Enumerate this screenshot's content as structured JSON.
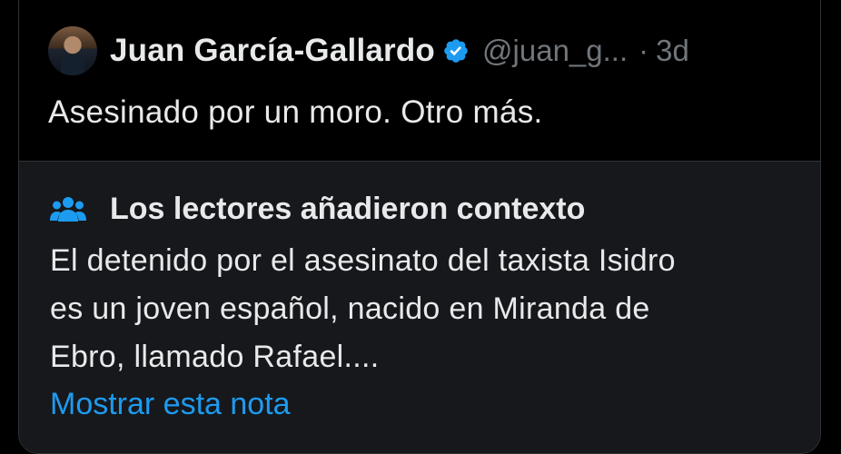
{
  "tweet": {
    "author_name": "Juan García-Gallardo",
    "handle": "@juan_g...",
    "separator": "·",
    "time": "3d",
    "text": "Asesinado por un moro. Otro más.",
    "verified_icon": "verified-badge-icon",
    "avatar": "author-avatar"
  },
  "community_note": {
    "icon": "people-icon",
    "title": "Los lectores añadieron contexto",
    "lines": [
      "El detenido por el asesinato del taxista Isidro",
      "es un joven español, nacido en Miranda de",
      "Ebro, llamado Rafael...."
    ],
    "show_more": "Mostrar esta nota"
  },
  "colors": {
    "background": "#000000",
    "note_background": "#16181c",
    "border": "#2f3336",
    "primary_text": "#e7e9ea",
    "secondary_text": "#71767b",
    "accent": "#1d9bf0"
  }
}
